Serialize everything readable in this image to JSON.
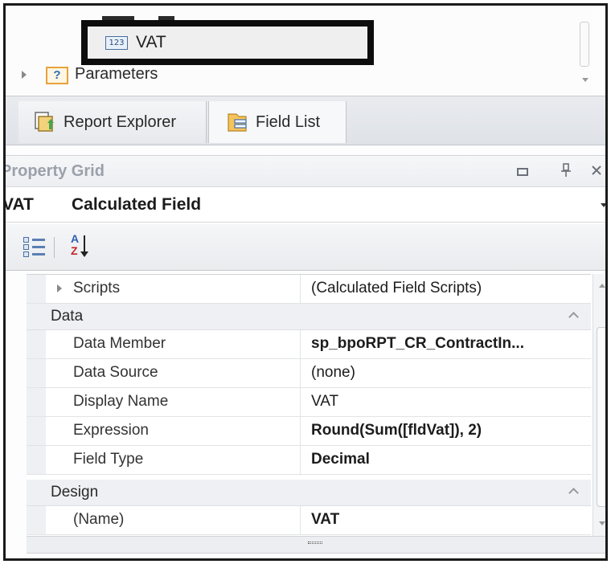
{
  "tree": {
    "selected_node": {
      "label": "VAT",
      "icon": "number-123-icon",
      "icon_text": "123"
    },
    "parameters_node": {
      "label": "Parameters",
      "icon": "question-icon",
      "icon_text": "?"
    }
  },
  "tabs": [
    {
      "label": "Report Explorer",
      "icon": "report-explorer-icon",
      "active": false
    },
    {
      "label": "Field List",
      "icon": "field-list-icon",
      "active": true
    }
  ],
  "property_grid": {
    "title": "Property Grid",
    "selected_object": {
      "name": "VAT",
      "type": "Calculated Field"
    },
    "toolbar": {
      "categorized_icon": "categorized-icon",
      "sort_icon": "alphabetical-sort-icon",
      "sort_a": "A",
      "sort_z": "Z"
    },
    "rows": [
      {
        "kind": "property",
        "name": "Scripts",
        "value": "(Calculated Field Scripts)",
        "bold": false,
        "expandable": true
      },
      {
        "kind": "category",
        "name": "Data"
      },
      {
        "kind": "property",
        "name": "Data Member",
        "value": "sp_bpoRPT_CR_ContractIn...",
        "bold": true
      },
      {
        "kind": "property",
        "name": "Data Source",
        "value": "(none)",
        "bold": false
      },
      {
        "kind": "property",
        "name": "Display Name",
        "value": "VAT",
        "bold": false
      },
      {
        "kind": "property",
        "name": "Expression",
        "value": "Round(Sum([fldVat]), 2)",
        "bold": true
      },
      {
        "kind": "property",
        "name": "Field Type",
        "value": "Decimal",
        "bold": true
      },
      {
        "kind": "category",
        "name": "Design"
      },
      {
        "kind": "property",
        "name": "(Name)",
        "value": "VAT",
        "bold": true
      }
    ]
  },
  "colors": {
    "accent": "#2e6fb8",
    "highlight_border": "#0d0d0d",
    "category_bg": "#eef0f3"
  }
}
